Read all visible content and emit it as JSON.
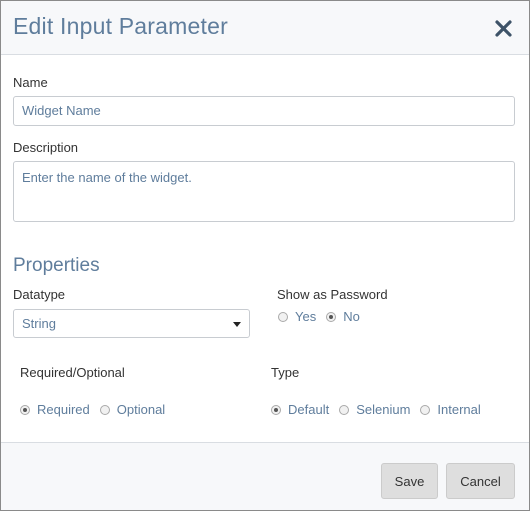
{
  "dialog": {
    "title": "Edit Input Parameter",
    "close_icon": "close-icon"
  },
  "form": {
    "name_label": "Name",
    "name_value": "Widget Name",
    "description_label": "Description",
    "description_value": "Enter the name of the widget.",
    "properties_title": "Properties",
    "datatype_label": "Datatype",
    "datatype_selected": "String",
    "show_password_label": "Show as Password",
    "show_password_options": [
      {
        "label": "Yes",
        "checked": false
      },
      {
        "label": "No",
        "checked": true
      }
    ],
    "required_label": "Required/Optional",
    "required_options": [
      {
        "label": "Required",
        "checked": true
      },
      {
        "label": "Optional",
        "checked": false
      }
    ],
    "type_label": "Type",
    "type_options": [
      {
        "label": "Default",
        "checked": true
      },
      {
        "label": "Selenium",
        "checked": false
      },
      {
        "label": "Internal",
        "checked": false
      }
    ]
  },
  "footer": {
    "save_label": "Save",
    "cancel_label": "Cancel"
  },
  "colors": {
    "accent": "#5f7d9c",
    "header_bg": "#f7f8fa",
    "button_bg": "#dedede"
  }
}
